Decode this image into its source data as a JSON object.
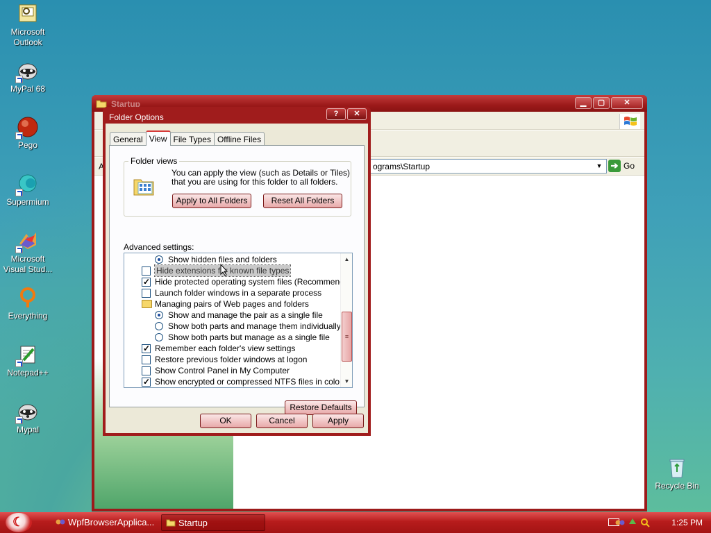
{
  "desktop": {
    "icons": [
      {
        "label": "Microsoft Outlook",
        "icon": "outlook-icon"
      },
      {
        "label": "MyPal 68",
        "icon": "mypal-icon"
      },
      {
        "label": "Pego",
        "icon": "pego-icon"
      },
      {
        "label": "Supermium",
        "icon": "supermium-icon"
      },
      {
        "label": "Microsoft Visual Stud...",
        "icon": "visual-studio-icon"
      },
      {
        "label": "Everything",
        "icon": "everything-icon"
      },
      {
        "label": "Notepad++",
        "icon": "notepadpp-icon"
      },
      {
        "label": "Mypal",
        "icon": "mypal-icon"
      },
      {
        "label": "Recycle Bin",
        "icon": "recycle-bin-icon"
      }
    ]
  },
  "explorer": {
    "title": "Startup",
    "address_label": "A",
    "address_value": "ograms\\Startup",
    "go_label": "Go"
  },
  "dialog": {
    "title": "Folder Options",
    "help_label": "?",
    "close_label": "✕",
    "tabs": [
      {
        "label": "General",
        "active": false
      },
      {
        "label": "View",
        "active": true
      },
      {
        "label": "File Types",
        "active": false
      },
      {
        "label": "Offline Files",
        "active": false
      }
    ],
    "folder_views": {
      "legend": "Folder views",
      "description": "You can apply the view (such as Details or Tiles) that you are using for this folder to all folders.",
      "apply_all": "Apply to All Folders",
      "reset_all": "Reset All Folders"
    },
    "advanced_label": "Advanced settings:",
    "advanced": [
      {
        "type": "radio",
        "checked": true,
        "indent": 2,
        "text": "Show hidden files and folders"
      },
      {
        "type": "check",
        "checked": false,
        "indent": 1,
        "text": "Hide extensions for known file types",
        "selected": true
      },
      {
        "type": "check",
        "checked": true,
        "indent": 1,
        "text": "Hide protected operating system files (Recommended)"
      },
      {
        "type": "check",
        "checked": false,
        "indent": 1,
        "text": "Launch folder windows in a separate process"
      },
      {
        "type": "folder",
        "checked": false,
        "indent": 1,
        "text": "Managing pairs of Web pages and folders"
      },
      {
        "type": "radio",
        "checked": true,
        "indent": 2,
        "text": "Show and manage the pair as a single file"
      },
      {
        "type": "radio",
        "checked": false,
        "indent": 2,
        "text": "Show both parts and manage them individually"
      },
      {
        "type": "radio",
        "checked": false,
        "indent": 2,
        "text": "Show both parts but manage as a single file"
      },
      {
        "type": "check",
        "checked": true,
        "indent": 1,
        "text": "Remember each folder's view settings"
      },
      {
        "type": "check",
        "checked": false,
        "indent": 1,
        "text": "Restore previous folder windows at logon"
      },
      {
        "type": "check",
        "checked": false,
        "indent": 1,
        "text": "Show Control Panel in My Computer"
      },
      {
        "type": "check",
        "checked": true,
        "indent": 1,
        "text": "Show encrypted or compressed NTFS files in color"
      }
    ],
    "restore_defaults": "Restore Defaults",
    "ok": "OK",
    "cancel": "Cancel",
    "apply": "Apply"
  },
  "taskbar": {
    "items": [
      {
        "label": "WpfBrowserApplica...",
        "active": false
      },
      {
        "label": "Startup",
        "active": true
      }
    ],
    "clock": "1:25 PM"
  },
  "colors": {
    "accent": "#a01c1c",
    "taskbar": "#b71c1c",
    "dialog_face": "#ece9d8"
  }
}
